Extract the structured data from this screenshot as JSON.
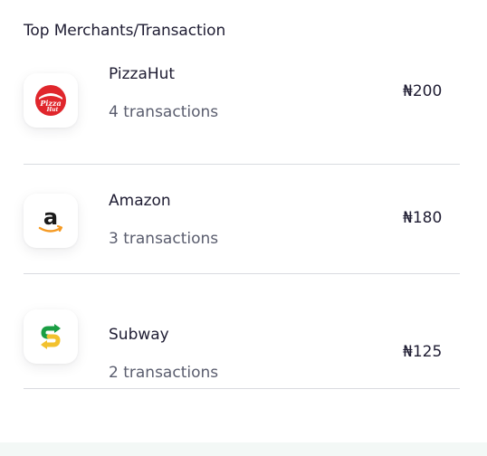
{
  "section": {
    "title": "Top Merchants/Transaction"
  },
  "merchants": [
    {
      "name": "PizzaHut",
      "transactions": "4 transactions",
      "amount": "₦200",
      "logo_icon": "pizzahut-logo-icon"
    },
    {
      "name": "Amazon",
      "transactions": "3 transactions",
      "amount": "₦180",
      "logo_icon": "amazon-logo-icon"
    },
    {
      "name": "Subway",
      "transactions": "2 transactions",
      "amount": "₦125",
      "logo_icon": "subway-logo-icon"
    }
  ],
  "colors": {
    "text_primary": "#1f1d33",
    "text_secondary": "#5a5d6e",
    "divider": "#d9dbe0",
    "pizzahut_red": "#e0262c",
    "amazon_orange": "#f59a23",
    "subway_green": "#1a9e43",
    "subway_yellow": "#f2c12e"
  }
}
